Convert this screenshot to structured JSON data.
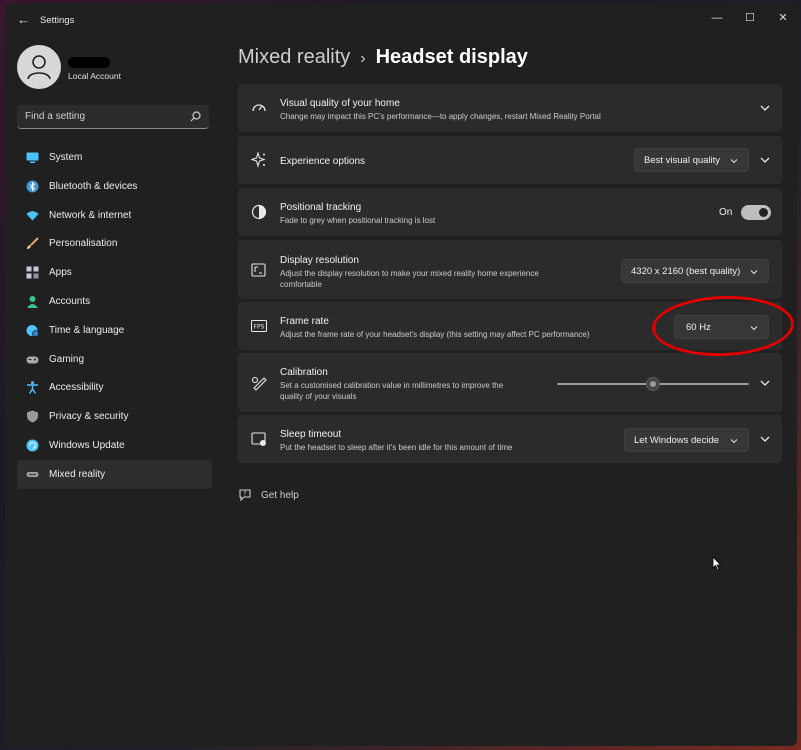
{
  "window": {
    "title": "Settings"
  },
  "profile": {
    "account_type": "Local Account"
  },
  "search": {
    "placeholder": "Find a setting"
  },
  "sidebar": {
    "items": [
      {
        "label": "System",
        "icon": "monitor-icon",
        "color": "#4cc2ff"
      },
      {
        "label": "Bluetooth & devices",
        "icon": "bluetooth-icon",
        "color": "#3a96dd"
      },
      {
        "label": "Network & internet",
        "icon": "wifi-icon",
        "color": "#4cc2ff"
      },
      {
        "label": "Personalisation",
        "icon": "brush-icon",
        "color": "#e8a87c"
      },
      {
        "label": "Apps",
        "icon": "apps-icon",
        "color": "#c8c8d8"
      },
      {
        "label": "Accounts",
        "icon": "person-icon",
        "color": "#3cc48a"
      },
      {
        "label": "Time & language",
        "icon": "globe-clock-icon",
        "color": "#4cc2ff"
      },
      {
        "label": "Gaming",
        "icon": "gamepad-icon",
        "color": "#aaaaaa"
      },
      {
        "label": "Accessibility",
        "icon": "accessibility-icon",
        "color": "#4cc2ff"
      },
      {
        "label": "Privacy & security",
        "icon": "shield-icon",
        "color": "#9a9a9a"
      },
      {
        "label": "Windows Update",
        "icon": "update-icon",
        "color": "#4cc2ff"
      },
      {
        "label": "Mixed reality",
        "icon": "headset-icon",
        "color": "#aaaaaa",
        "active": true
      }
    ]
  },
  "breadcrumb": {
    "parent": "Mixed reality",
    "separator": "›",
    "current": "Headset display"
  },
  "cards": {
    "visual_quality": {
      "title": "Visual quality of your home",
      "subtitle": "Change may impact this PC's performance—to apply changes, restart Mixed Reality Portal"
    },
    "experience": {
      "title": "Experience options",
      "value": "Best visual quality"
    },
    "positional": {
      "title": "Positional tracking",
      "subtitle": "Fade to grey when positional tracking is lost",
      "state": "On",
      "on": true
    },
    "resolution": {
      "title": "Display resolution",
      "subtitle_line1": "Adjust the display resolution to make your mixed reality home experience",
      "subtitle_line2": "comfortable",
      "value": "4320 x 2160 (best quality)"
    },
    "frame_rate": {
      "title": "Frame rate",
      "subtitle": "Adjust the frame rate of your headset's display (this setting may affect PC performance)",
      "value": "60 Hz"
    },
    "calibration": {
      "title": "Calibration",
      "subtitle_line1": "Set a customised calibration value in millimetres to improve the",
      "subtitle_line2": "quality of your visuals",
      "slider_fraction": 0.5
    },
    "sleep": {
      "title": "Sleep timeout",
      "subtitle": "Put the headset to sleep after it's been idle for this amount of time",
      "value": "Let Windows decide"
    }
  },
  "help": {
    "label": "Get help"
  },
  "colors": {
    "accent": "#76b9ed",
    "annotation": "#e00000",
    "card_bg": "#2b2b2b",
    "window_bg": "#202020"
  }
}
